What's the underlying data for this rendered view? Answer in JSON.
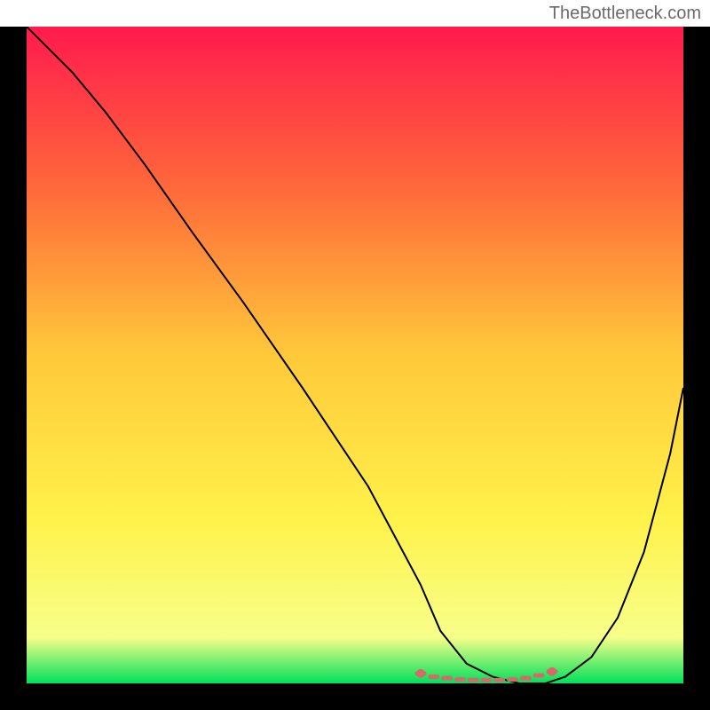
{
  "watermark": "TheBottleneck.com",
  "chart_data": {
    "type": "line",
    "title": "",
    "xlabel": "",
    "ylabel": "",
    "xlim": [
      0,
      100
    ],
    "ylim": [
      0,
      100
    ],
    "background": "gradient-heatmap",
    "gradient_stops": [
      {
        "offset": 0.0,
        "color": "#ff1a4d"
      },
      {
        "offset": 0.25,
        "color": "#ff6a3a"
      },
      {
        "offset": 0.5,
        "color": "#ffc93a"
      },
      {
        "offset": 0.75,
        "color": "#fff24a"
      },
      {
        "offset": 0.93,
        "color": "#f7ff8a"
      },
      {
        "offset": 1.0,
        "color": "#00e05a"
      }
    ],
    "series": [
      {
        "name": "bottleneck-curve",
        "color": "#000000",
        "x": [
          0,
          3,
          7,
          12,
          18,
          25,
          33,
          42,
          52,
          60,
          63,
          67,
          71,
          75,
          79,
          82,
          86,
          90,
          94,
          98,
          100
        ],
        "y": [
          100,
          97,
          93,
          87,
          79,
          69,
          58,
          45,
          30,
          15,
          8,
          3,
          1,
          0,
          0,
          1,
          4,
          10,
          20,
          35,
          45
        ]
      }
    ],
    "markers": {
      "name": "floor-dots",
      "color": "#d46a6a",
      "shape": "dot-dash",
      "x": [
        60,
        62,
        64,
        66,
        68,
        70,
        72,
        74,
        76,
        78,
        80
      ],
      "y": [
        1.5,
        1.0,
        0.8,
        0.6,
        0.5,
        0.5,
        0.5,
        0.6,
        0.8,
        1.2,
        1.8
      ]
    }
  }
}
